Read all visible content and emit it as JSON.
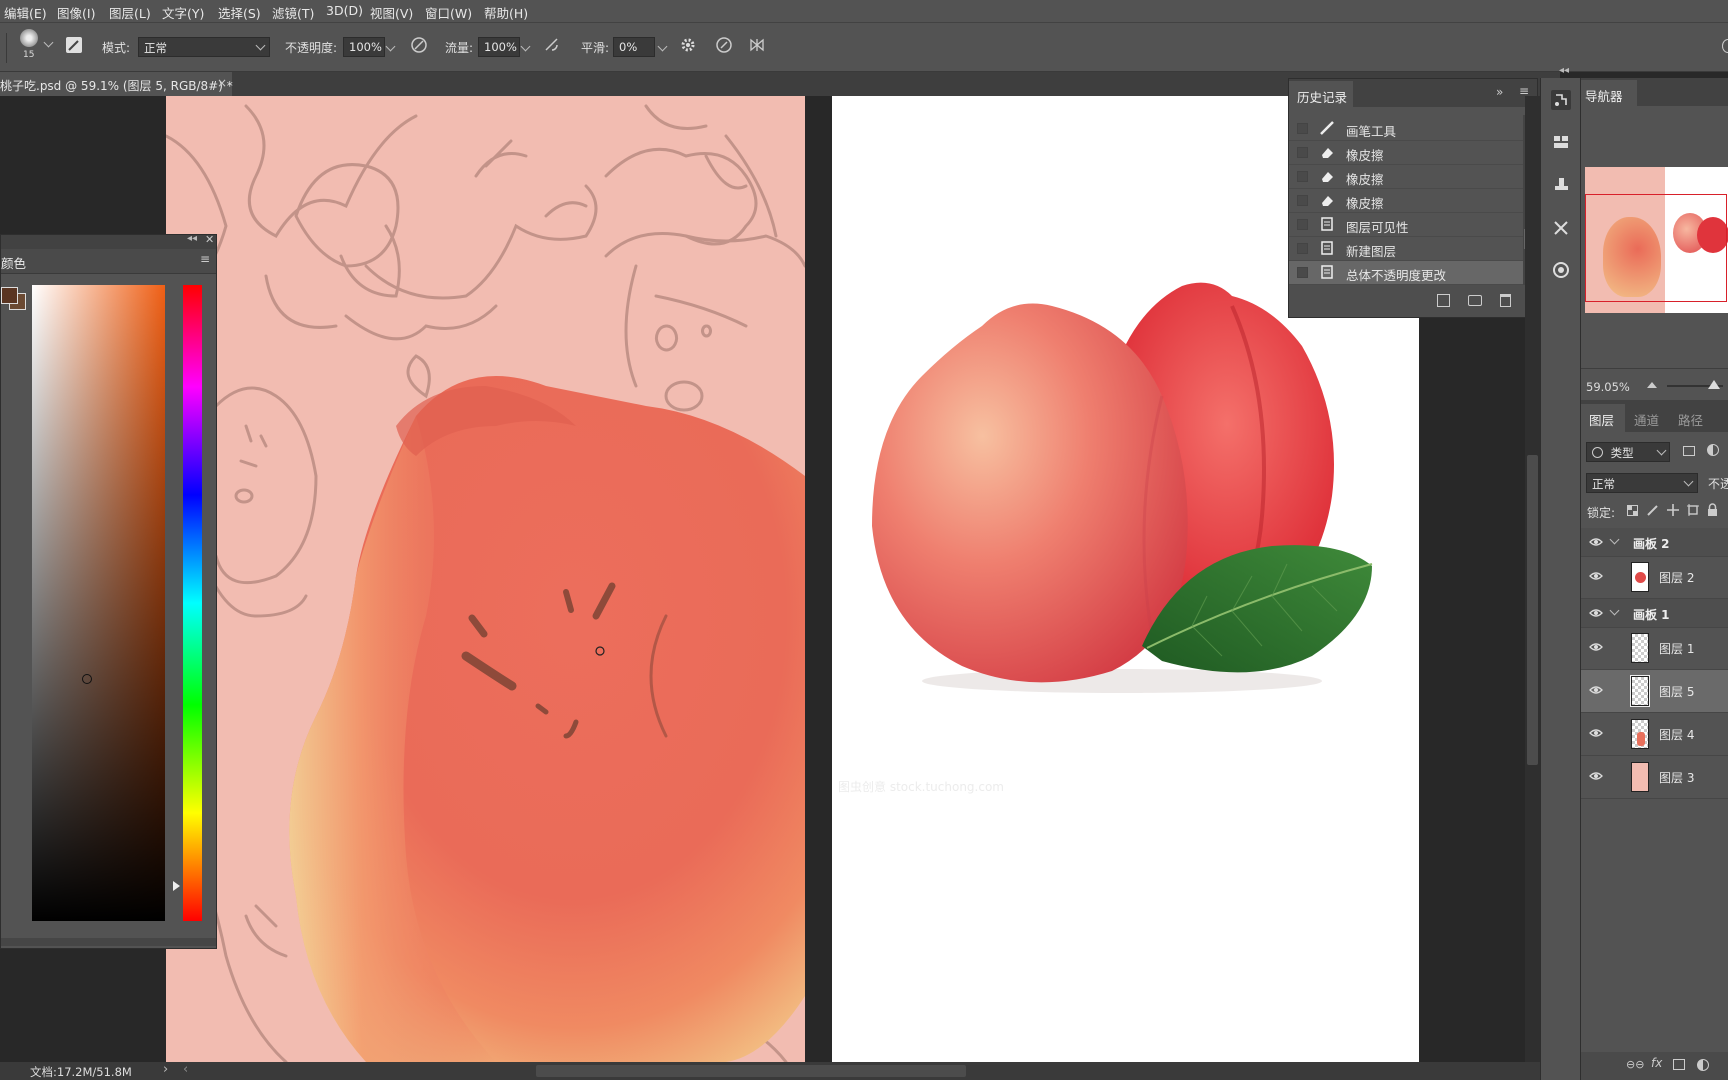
{
  "menu": [
    "编辑(E)",
    "图像(I)",
    "图层(L)",
    "文字(Y)",
    "选择(S)",
    "滤镜(T)",
    "3D(D)",
    "视图(V)",
    "窗口(W)",
    "帮助(H)"
  ],
  "options": {
    "brush_size": "15",
    "mode_label": "模式:",
    "mode_value": "正常",
    "opacity_label": "不透明度:",
    "opacity_value": "100%",
    "flow_label": "流量:",
    "flow_value": "100%",
    "smooth_label": "平滑:",
    "smooth_value": "0%"
  },
  "document_tab": {
    "title": "桃子吃.psd @ 59.1% (图层 5, RGB/8#) *",
    "close": "×"
  },
  "color_panel": {
    "title": "颜色",
    "foreground": "#5a3522",
    "background": "#6b4a33"
  },
  "history_panel": {
    "title": "历史记录",
    "items": [
      "画笔工具",
      "橡皮擦",
      "橡皮擦",
      "橡皮擦",
      "图层可见性",
      "新建图层",
      "总体不透明度更改"
    ]
  },
  "navigator": {
    "title": "导航器",
    "zoom": "59.05%"
  },
  "layers_panel": {
    "tabs": [
      "图层",
      "通道",
      "路径"
    ],
    "filter_label": "类型",
    "blend_mode": "正常",
    "opacity_label": "不透",
    "lock_label": "锁定:",
    "groups": [
      {
        "name": "画板 2",
        "layers": [
          "图层 2"
        ]
      },
      {
        "name": "画板 1",
        "layers": [
          "图层 1",
          "图层 5",
          "图层 4",
          "图层 3"
        ]
      }
    ]
  },
  "watermark": "图虫创意 stock.tuchong.com",
  "status": {
    "doc_size": "文档:17.2M/51.8M"
  }
}
